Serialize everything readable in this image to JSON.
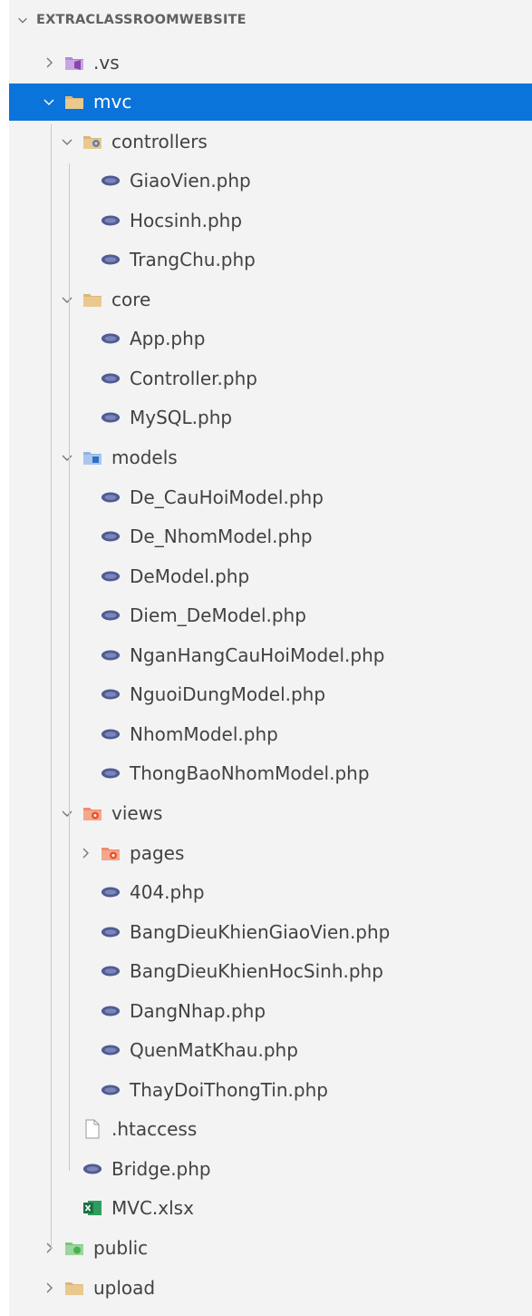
{
  "explorer": {
    "title": "EXTRACLASSROOMWEBSITE",
    "items": [
      {
        "label": ".vs",
        "kind": "folder",
        "icon": "vs-folder-icon",
        "depth": 0,
        "chevron": "right"
      },
      {
        "label": "mvc",
        "kind": "folder",
        "icon": "folder-icon",
        "depth": 0,
        "chevron": "down",
        "selected": true
      },
      {
        "label": "controllers",
        "kind": "folder",
        "icon": "controllers-folder-icon",
        "depth": 1,
        "chevron": "down"
      },
      {
        "label": "GiaoVien.php",
        "kind": "file",
        "icon": "php-icon",
        "depth": 2
      },
      {
        "label": "Hocsinh.php",
        "kind": "file",
        "icon": "php-icon",
        "depth": 2
      },
      {
        "label": "TrangChu.php",
        "kind": "file",
        "icon": "php-icon",
        "depth": 2
      },
      {
        "label": "core",
        "kind": "folder",
        "icon": "folder-icon",
        "depth": 1,
        "chevron": "down"
      },
      {
        "label": "App.php",
        "kind": "file",
        "icon": "php-icon",
        "depth": 2
      },
      {
        "label": "Controller.php",
        "kind": "file",
        "icon": "php-icon",
        "depth": 2
      },
      {
        "label": "MySQL.php",
        "kind": "file",
        "icon": "php-icon",
        "depth": 2
      },
      {
        "label": "models",
        "kind": "folder",
        "icon": "models-folder-icon",
        "depth": 1,
        "chevron": "down"
      },
      {
        "label": "De_CauHoiModel.php",
        "kind": "file",
        "icon": "php-icon",
        "depth": 2
      },
      {
        "label": "De_NhomModel.php",
        "kind": "file",
        "icon": "php-icon",
        "depth": 2
      },
      {
        "label": "DeModel.php",
        "kind": "file",
        "icon": "php-icon",
        "depth": 2
      },
      {
        "label": "Diem_DeModel.php",
        "kind": "file",
        "icon": "php-icon",
        "depth": 2
      },
      {
        "label": "NganHangCauHoiModel.php",
        "kind": "file",
        "icon": "php-icon",
        "depth": 2
      },
      {
        "label": "NguoiDungModel.php",
        "kind": "file",
        "icon": "php-icon",
        "depth": 2
      },
      {
        "label": "NhomModel.php",
        "kind": "file",
        "icon": "php-icon",
        "depth": 2
      },
      {
        "label": "ThongBaoNhomModel.php",
        "kind": "file",
        "icon": "php-icon",
        "depth": 2
      },
      {
        "label": "views",
        "kind": "folder",
        "icon": "views-folder-icon",
        "depth": 1,
        "chevron": "down"
      },
      {
        "label": "pages",
        "kind": "folder",
        "icon": "views-folder-icon",
        "depth": 2,
        "chevron": "right"
      },
      {
        "label": "404.php",
        "kind": "file",
        "icon": "php-icon",
        "depth": 2
      },
      {
        "label": "BangDieuKhienGiaoVien.php",
        "kind": "file",
        "icon": "php-icon",
        "depth": 2
      },
      {
        "label": "BangDieuKhienHocSinh.php",
        "kind": "file",
        "icon": "php-icon",
        "depth": 2
      },
      {
        "label": "DangNhap.php",
        "kind": "file",
        "icon": "php-icon",
        "depth": 2
      },
      {
        "label": "QuenMatKhau.php",
        "kind": "file",
        "icon": "php-icon",
        "depth": 2
      },
      {
        "label": "ThayDoiThongTin.php",
        "kind": "file",
        "icon": "php-icon",
        "depth": 2
      },
      {
        "label": ".htaccess",
        "kind": "file",
        "icon": "file-icon",
        "depth": 1
      },
      {
        "label": "Bridge.php",
        "kind": "file",
        "icon": "php-icon",
        "depth": 1
      },
      {
        "label": "MVC.xlsx",
        "kind": "file",
        "icon": "excel-icon",
        "depth": 1
      },
      {
        "label": "public",
        "kind": "folder",
        "icon": "public-folder-icon",
        "depth": 0,
        "chevron": "right"
      },
      {
        "label": "upload",
        "kind": "folder",
        "icon": "folder-icon",
        "depth": 0,
        "chevron": "right"
      }
    ]
  },
  "colors": {
    "selection": "#0a74db",
    "php": "#4f5b93",
    "folder": "#dcb67a",
    "views": "#e8532c",
    "excel": "#1d7044",
    "public": "#4caf50",
    "vs": "#8e44ad"
  }
}
